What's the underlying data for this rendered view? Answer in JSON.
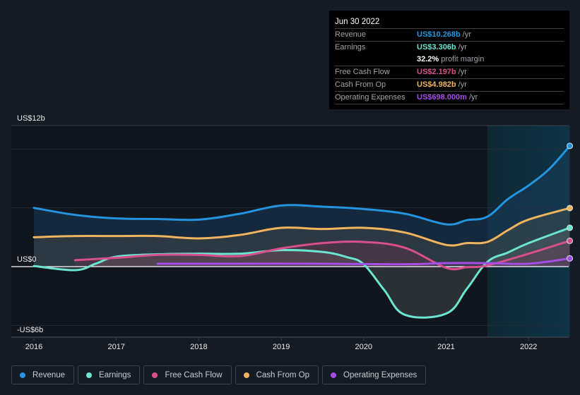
{
  "tooltip": {
    "date": "Jun 30 2022",
    "rows": [
      {
        "label": "Revenue",
        "value": "US$10.268b",
        "unit": "/yr",
        "color": "#2394df"
      },
      {
        "label": "Earnings",
        "value": "US$3.306b",
        "unit": "/yr",
        "color": "#6ce5d0"
      },
      {
        "label": "",
        "value": "32.2%",
        "unit": "profit margin",
        "color": "#ffffff"
      },
      {
        "label": "Free Cash Flow",
        "value": "US$2.197b",
        "unit": "/yr",
        "color": "#d84f8c"
      },
      {
        "label": "Cash From Op",
        "value": "US$4.982b",
        "unit": "/yr",
        "color": "#f0b35e"
      },
      {
        "label": "Operating Expenses",
        "value": "US$698.000m",
        "unit": "/yr",
        "color": "#a54ee6"
      }
    ]
  },
  "legend": [
    {
      "label": "Revenue",
      "color": "#2394df"
    },
    {
      "label": "Earnings",
      "color": "#6ce5d0"
    },
    {
      "label": "Free Cash Flow",
      "color": "#d84f8c"
    },
    {
      "label": "Cash From Op",
      "color": "#f0b35e"
    },
    {
      "label": "Operating Expenses",
      "color": "#a54ee6"
    }
  ],
  "chart_data": {
    "type": "area",
    "title": "",
    "xlabel": "",
    "ylabel": "",
    "ylim": [
      -6,
      12
    ],
    "xlim": [
      2015.72,
      2022.5
    ],
    "y_tick_labels": [
      {
        "value": 12,
        "label": "US$12b"
      },
      {
        "value": 0,
        "label": "US$0"
      },
      {
        "value": -6,
        "label": "-US$6b"
      }
    ],
    "gridlines": [
      12,
      10,
      5,
      0,
      -5
    ],
    "x_ticks": [
      2016,
      2017,
      2018,
      2019,
      2020,
      2021,
      2022
    ],
    "highlight_range": [
      2021.5,
      2022.5
    ],
    "units": "US$ billions",
    "series": [
      {
        "name": "Revenue",
        "color": "#2394df",
        "x": [
          2016.0,
          2016.5,
          2017.0,
          2017.5,
          2018.0,
          2018.5,
          2019.0,
          2019.5,
          2020.0,
          2020.5,
          2021.0,
          2021.25,
          2021.5,
          2021.75,
          2022.0,
          2022.25,
          2022.5
        ],
        "values": [
          5.0,
          4.4,
          4.1,
          4.05,
          4.0,
          4.5,
          5.2,
          5.1,
          4.9,
          4.5,
          3.6,
          3.95,
          4.25,
          5.75,
          6.9,
          8.3,
          10.268
        ]
      },
      {
        "name": "Cash From Op",
        "color": "#f0b35e",
        "x": [
          2016.0,
          2016.5,
          2017.0,
          2017.5,
          2018.0,
          2018.5,
          2019.0,
          2019.5,
          2020.0,
          2020.5,
          2021.0,
          2021.25,
          2021.5,
          2021.75,
          2022.0,
          2022.5
        ],
        "values": [
          2.5,
          2.6,
          2.6,
          2.6,
          2.4,
          2.7,
          3.3,
          3.2,
          3.3,
          2.9,
          1.85,
          2.0,
          2.1,
          3.1,
          4.0,
          4.982
        ]
      },
      {
        "name": "Earnings",
        "color": "#6ce5d0",
        "x": [
          2016.0,
          2016.5,
          2016.75,
          2017.0,
          2017.5,
          2018.0,
          2018.5,
          2019.0,
          2019.5,
          2019.8,
          2020.0,
          2020.25,
          2020.5,
          2021.0,
          2021.25,
          2021.5,
          2021.75,
          2022.0,
          2022.5
        ],
        "values": [
          0.05,
          -0.3,
          0.25,
          0.85,
          1.05,
          1.1,
          1.1,
          1.4,
          1.25,
          0.8,
          0.2,
          -2.0,
          -4.1,
          -4.0,
          -1.9,
          0.4,
          1.2,
          2.0,
          3.306
        ]
      },
      {
        "name": "Free Cash Flow",
        "color": "#d84f8c",
        "x": [
          2016.5,
          2017.0,
          2017.5,
          2018.0,
          2018.5,
          2019.0,
          2019.5,
          2020.0,
          2020.5,
          2021.0,
          2021.25,
          2021.5,
          2022.0,
          2022.5
        ],
        "values": [
          0.55,
          0.75,
          1.0,
          1.0,
          0.9,
          1.55,
          2.0,
          2.1,
          1.6,
          -0.1,
          -0.05,
          0.1,
          1.1,
          2.197
        ]
      },
      {
        "name": "Operating Expenses",
        "color": "#a54ee6",
        "x": [
          2017.5,
          2018.5,
          2019.5,
          2020.5,
          2021.0,
          2021.5,
          2022.0,
          2022.5
        ],
        "values": [
          0.25,
          0.25,
          0.25,
          0.2,
          0.3,
          0.3,
          0.25,
          0.698
        ]
      }
    ]
  }
}
